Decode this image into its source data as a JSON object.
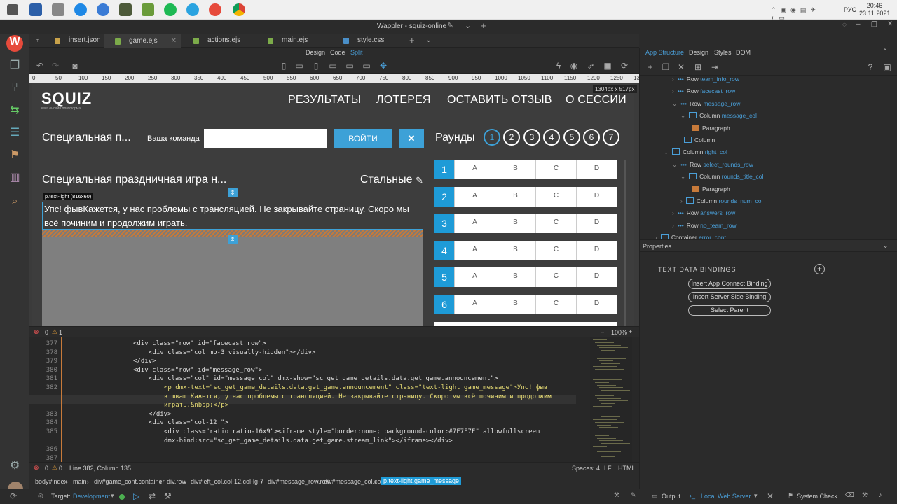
{
  "taskbar": {
    "clock_time": "20:46",
    "clock_date": "23.11.2021",
    "lang": "РУС"
  },
  "window": {
    "title": "Wappler - squiz-online"
  },
  "tabs": [
    {
      "label": "insert.json"
    },
    {
      "label": "game.ejs"
    },
    {
      "label": "actions.ejs"
    },
    {
      "label": "main.ejs"
    },
    {
      "label": "style.css"
    }
  ],
  "modes": {
    "design": "Design",
    "code": "Code",
    "split": "Split"
  },
  "ruler": {
    "ticks": [
      "0",
      "50",
      "100",
      "150",
      "200",
      "250",
      "300",
      "350",
      "400",
      "450",
      "500",
      "550",
      "600",
      "650",
      "700",
      "750",
      "800",
      "850",
      "900",
      "950",
      "1000",
      "1050",
      "1100",
      "1150",
      "1200",
      "1250",
      "1300"
    ],
    "size_label": "1304px x 517px"
  },
  "site": {
    "logo": "SQUIZ",
    "logo_sub": "квиз онлайн платформа",
    "nav": [
      "РЕЗУЛЬТАТЫ",
      "ЛОТЕРЕЯ",
      "ОСТАВИТЬ ОТЗЫВ",
      "О СЕССИИ"
    ],
    "game_title_short": "Специальная п...",
    "team_label": "Ваша команда",
    "team_placeholder": "",
    "login_button": "ВОЙТИ",
    "close_button": "✕",
    "rounds_label": "Раунды",
    "rounds": [
      "1",
      "2",
      "3",
      "4",
      "5",
      "6",
      "7"
    ],
    "game_title": "Специальная праздничная игра н...",
    "team_name": "Стальные",
    "element_tag": "p.text-light (816x60)",
    "message": "Упс! фывКажется, у нас проблемы с трансляцией. Не закрывайте страницу. Скоро мы всё починим и продолжим играть.",
    "answers": [
      {
        "num": "1",
        "a": "A",
        "b": "B",
        "c": "C",
        "d": "D"
      },
      {
        "num": "2",
        "a": "A",
        "b": "B",
        "c": "C",
        "d": "D"
      },
      {
        "num": "3",
        "a": "A",
        "b": "B",
        "c": "C",
        "d": "D"
      },
      {
        "num": "4",
        "a": "A",
        "b": "B",
        "c": "C",
        "d": "D"
      },
      {
        "num": "5",
        "a": "A",
        "b": "B",
        "c": "C",
        "d": "D"
      },
      {
        "num": "6",
        "a": "A",
        "b": "B",
        "c": "C",
        "d": "D"
      }
    ]
  },
  "status_top": {
    "errors": "0",
    "warnings": "1",
    "zoom": "100%"
  },
  "code_lines": [
    {
      "n": "377",
      "text": "<div class=\"row\" id=\"facecast_row\">",
      "indent": 0
    },
    {
      "n": "378",
      "text": "<div class=\"col mb-3 visually-hidden\"></div>",
      "indent": 1
    },
    {
      "n": "379",
      "text": "</div>",
      "indent": 0
    },
    {
      "n": "380",
      "text": "<div class=\"row\" id=\"message_row\">",
      "indent": 0
    },
    {
      "n": "381",
      "text": "<div class=\"col\" id=\"message_col\" dmx-show=\"sc_get_game_details.data.get_game.announcement\">",
      "indent": 1
    },
    {
      "n": "382",
      "text": "<p dmx-text=\"sc_get_game_details.data.get_game.announcement\" class=\"text-light game_message\">Упс! фыв",
      "indent": 2
    },
    {
      "n": "",
      "text": "в шваш Кажется, у нас проблемы с трансляцией. Не закрывайте страницу. Скоро мы всё починим и продолжим",
      "indent": 2
    },
    {
      "n": "",
      "text": "играть.&nbsp;</p>",
      "indent": 2
    },
    {
      "n": "383",
      "text": "</div>",
      "indent": 1
    },
    {
      "n": "384",
      "text": "<div class=\"col-12 \">",
      "indent": 1
    },
    {
      "n": "385",
      "text": "<div class=\"ratio ratio-16x9\"><iframe style=\"border:none; background-color:#7F7F7F\" allowfullscreen",
      "indent": 2
    },
    {
      "n": "",
      "text": "dmx-bind:src=\"sc_get_game_details.data.get_game.stream_link\"></iframe></div>",
      "indent": 2
    },
    {
      "n": "386",
      "text": "",
      "indent": 0
    },
    {
      "n": "387",
      "text": "",
      "indent": 0
    }
  ],
  "status_bot": {
    "errors": "0",
    "warnings": "0",
    "position": "Line 382, Column 135",
    "spaces": "Spaces: 4",
    "eol": "LF",
    "lang": "HTML"
  },
  "breadcrumb": [
    "body#index",
    "main",
    "div#game_cont.container",
    "div.row",
    "div#left_col.col-12.col-lg-7",
    "div#message_row.row",
    "div#message_col.col",
    "p.text-light.game_message"
  ],
  "bottom": {
    "target_label": "Target:",
    "target_value": "Development",
    "output": "Output",
    "server": "Local Web Server",
    "system_check": "System Check"
  },
  "right_panel": {
    "tabs": [
      "App Structure",
      "Design",
      "Styles",
      "DOM"
    ],
    "tree": [
      {
        "type": "Row",
        "id": "team_info_row",
        "depth": 3,
        "arrow": "›"
      },
      {
        "type": "Row",
        "id": "facecast_row",
        "depth": 3,
        "arrow": "›"
      },
      {
        "type": "Row",
        "id": "message_row",
        "depth": 3,
        "arrow": "⌄"
      },
      {
        "type": "Column",
        "id": "message_col",
        "depth": 4,
        "arrow": "⌄"
      },
      {
        "type": "Paragraph",
        "id": "",
        "depth": 5,
        "arrow": ""
      },
      {
        "type": "Column",
        "id": "",
        "depth": 4,
        "arrow": ""
      },
      {
        "type": "Column",
        "id": "right_col",
        "depth": 2,
        "arrow": "⌄"
      },
      {
        "type": "Row",
        "id": "select_rounds_row",
        "depth": 3,
        "arrow": "⌄"
      },
      {
        "type": "Column",
        "id": "rounds_title_col",
        "depth": 4,
        "arrow": "⌄"
      },
      {
        "type": "Paragraph",
        "id": "",
        "depth": 5,
        "arrow": ""
      },
      {
        "type": "Column",
        "id": "rounds_num_col",
        "depth": 4,
        "arrow": "›"
      },
      {
        "type": "Row",
        "id": "answers_row",
        "depth": 3,
        "arrow": "›"
      },
      {
        "type": "Row",
        "id": "no_team_row",
        "depth": 3,
        "arrow": "›"
      },
      {
        "type": "Container",
        "id": "error_cont",
        "depth": 1,
        "arrow": "›"
      }
    ],
    "properties_title": "Properties",
    "section_title": "TEXT DATA BINDINGS",
    "buttons": [
      "Insert App Connect Binding",
      "Insert Server Side Binding",
      "Select Parent"
    ]
  }
}
